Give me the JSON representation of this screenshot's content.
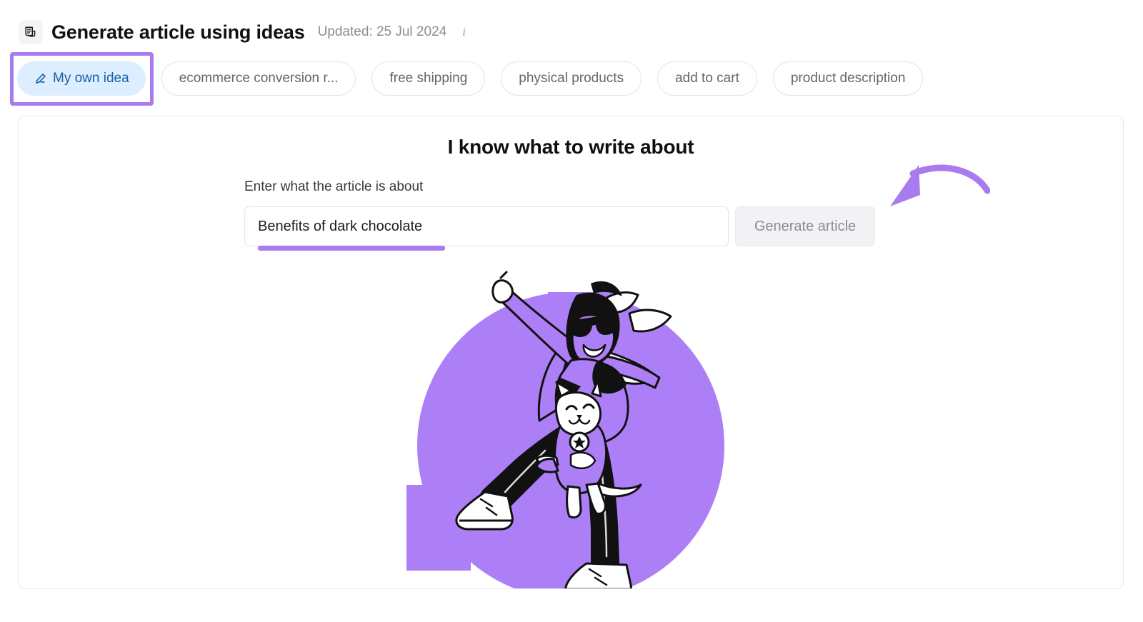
{
  "header": {
    "icon": "article-document-icon",
    "title": "Generate article using ideas",
    "updated": "Updated: 25 Jul 2024",
    "info_icon": "info-icon"
  },
  "chips": [
    {
      "label": "My own idea",
      "active": true,
      "icon": "pencil-icon"
    },
    {
      "label": "ecommerce conversion r...",
      "active": false
    },
    {
      "label": "free shipping",
      "active": false
    },
    {
      "label": "physical products",
      "active": false
    },
    {
      "label": "add to cart",
      "active": false
    },
    {
      "label": "product description",
      "active": false
    }
  ],
  "card": {
    "heading": "I know what to write about",
    "field_label": "Enter what the article is about",
    "input_value": "Benefits of dark chocolate",
    "input_placeholder": "Enter what the article is about",
    "generate_button": "Generate article"
  },
  "annotations": {
    "highlight_box": "purple-highlight-box",
    "underline": "purple-underline",
    "arrow": "purple-curved-arrow"
  },
  "colors": {
    "annotation_purple": "#a97bf0",
    "illustration_purple": "#ad7ff7",
    "chip_active_bg": "#dceeff",
    "chip_active_text": "#1a5fa8",
    "button_bg": "#f2f2f4",
    "button_text": "#8b8d94"
  },
  "illustration": {
    "name": "superhero-with-cat-illustration",
    "description": "Person in cape and sunglasses pointing upward while holding a cat, on a purple circle"
  }
}
